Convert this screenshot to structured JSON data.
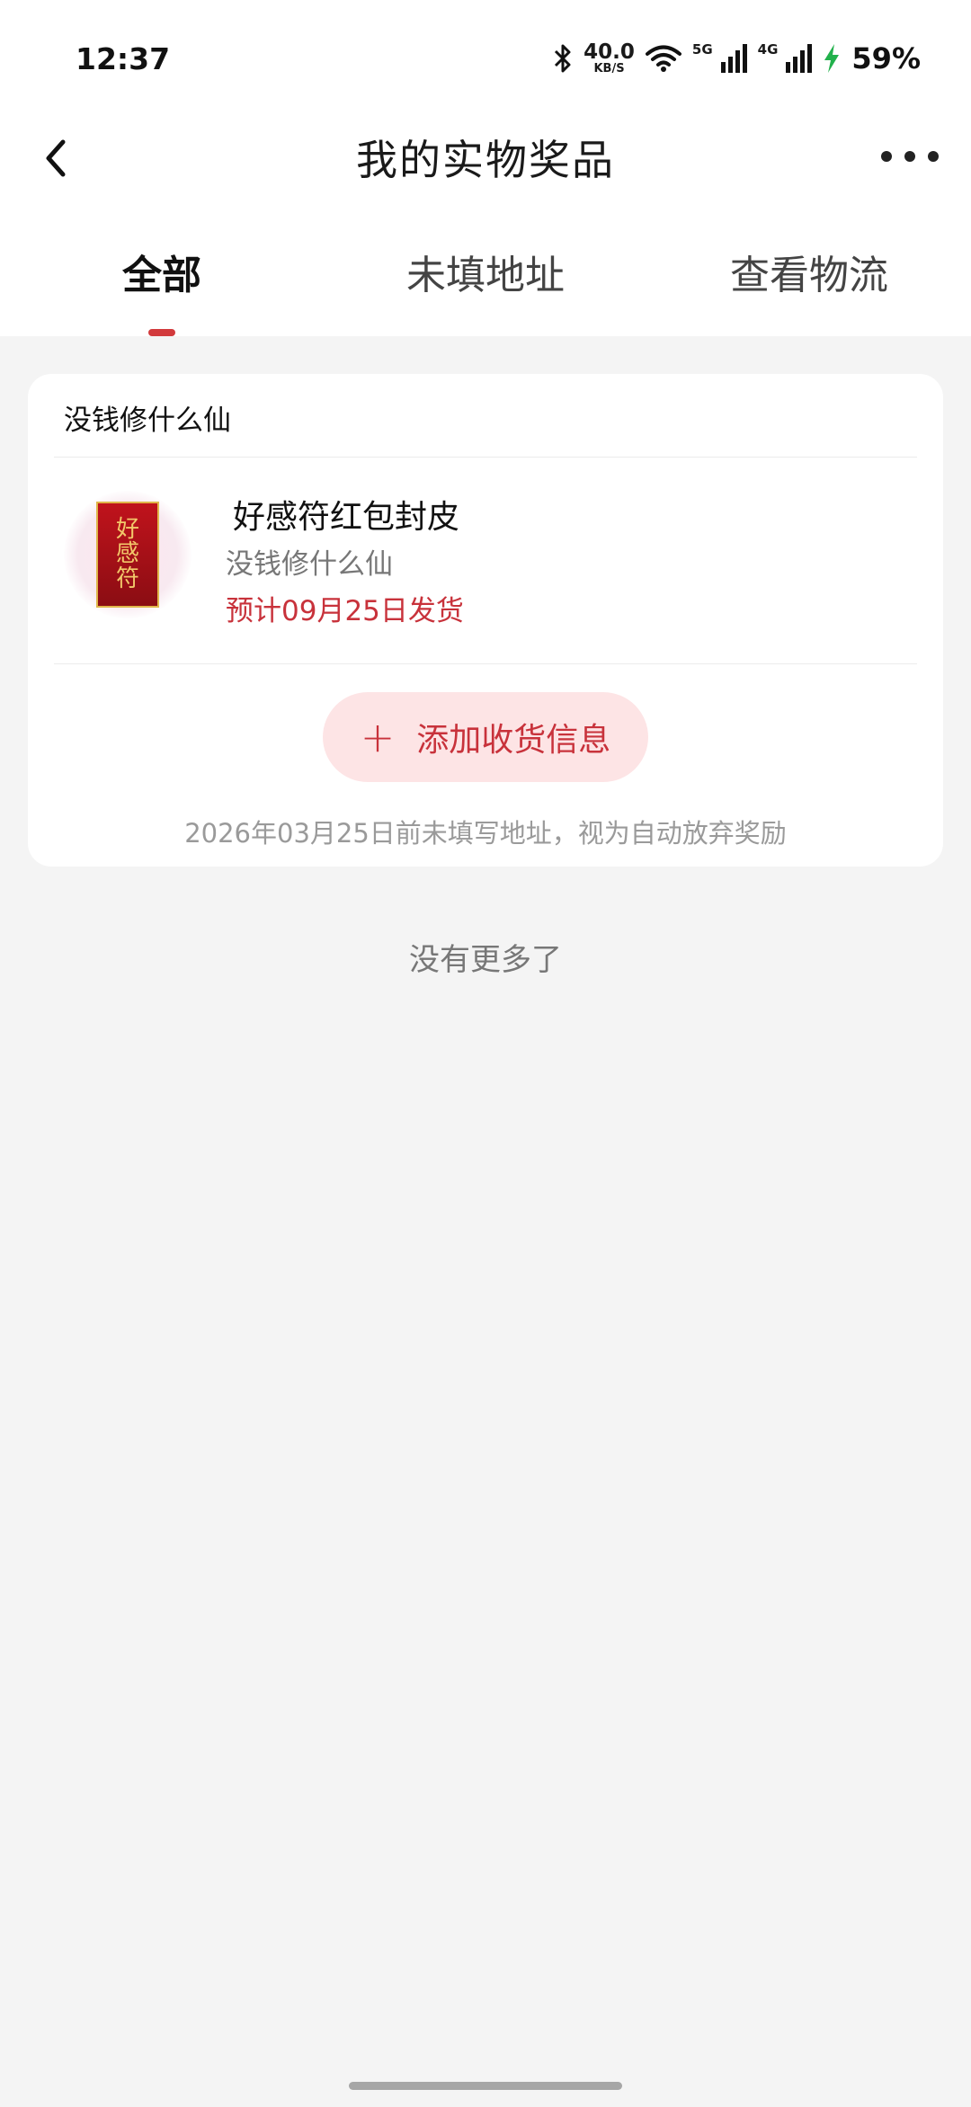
{
  "status_bar": {
    "time": "12:37",
    "speed_value": "40.0",
    "speed_unit": "KB/S",
    "net_5g": "5G",
    "net_4g": "4G",
    "battery": "59%",
    "icons": [
      "bluetooth-icon",
      "wifi-icon",
      "signal-5g-icon",
      "signal-4g-icon",
      "charging-icon"
    ]
  },
  "header": {
    "title": "我的实物奖品",
    "back_icon": "chevron-left-icon",
    "more_icon": "more-horizontal-icon"
  },
  "tabs": [
    {
      "label": "全部",
      "active": true
    },
    {
      "label": "未填地址",
      "active": false
    },
    {
      "label": "查看物流",
      "active": false
    }
  ],
  "prize_card": {
    "shop_name": "没钱修什么仙",
    "item": {
      "name": "好感符红包封皮",
      "subtitle": "没钱修什么仙",
      "shipping": "预计09月25日发货",
      "thumbnail_chars": [
        "好",
        "感",
        "符"
      ]
    },
    "add_button_label": "添加收货信息",
    "notice": "2026年03月25日前未填写地址，视为自动放弃奖励"
  },
  "footer_text": "没有更多了",
  "colors": {
    "accent": "#d23a3c",
    "background": "#f4f4f4",
    "button_bg": "#fde4e5"
  }
}
